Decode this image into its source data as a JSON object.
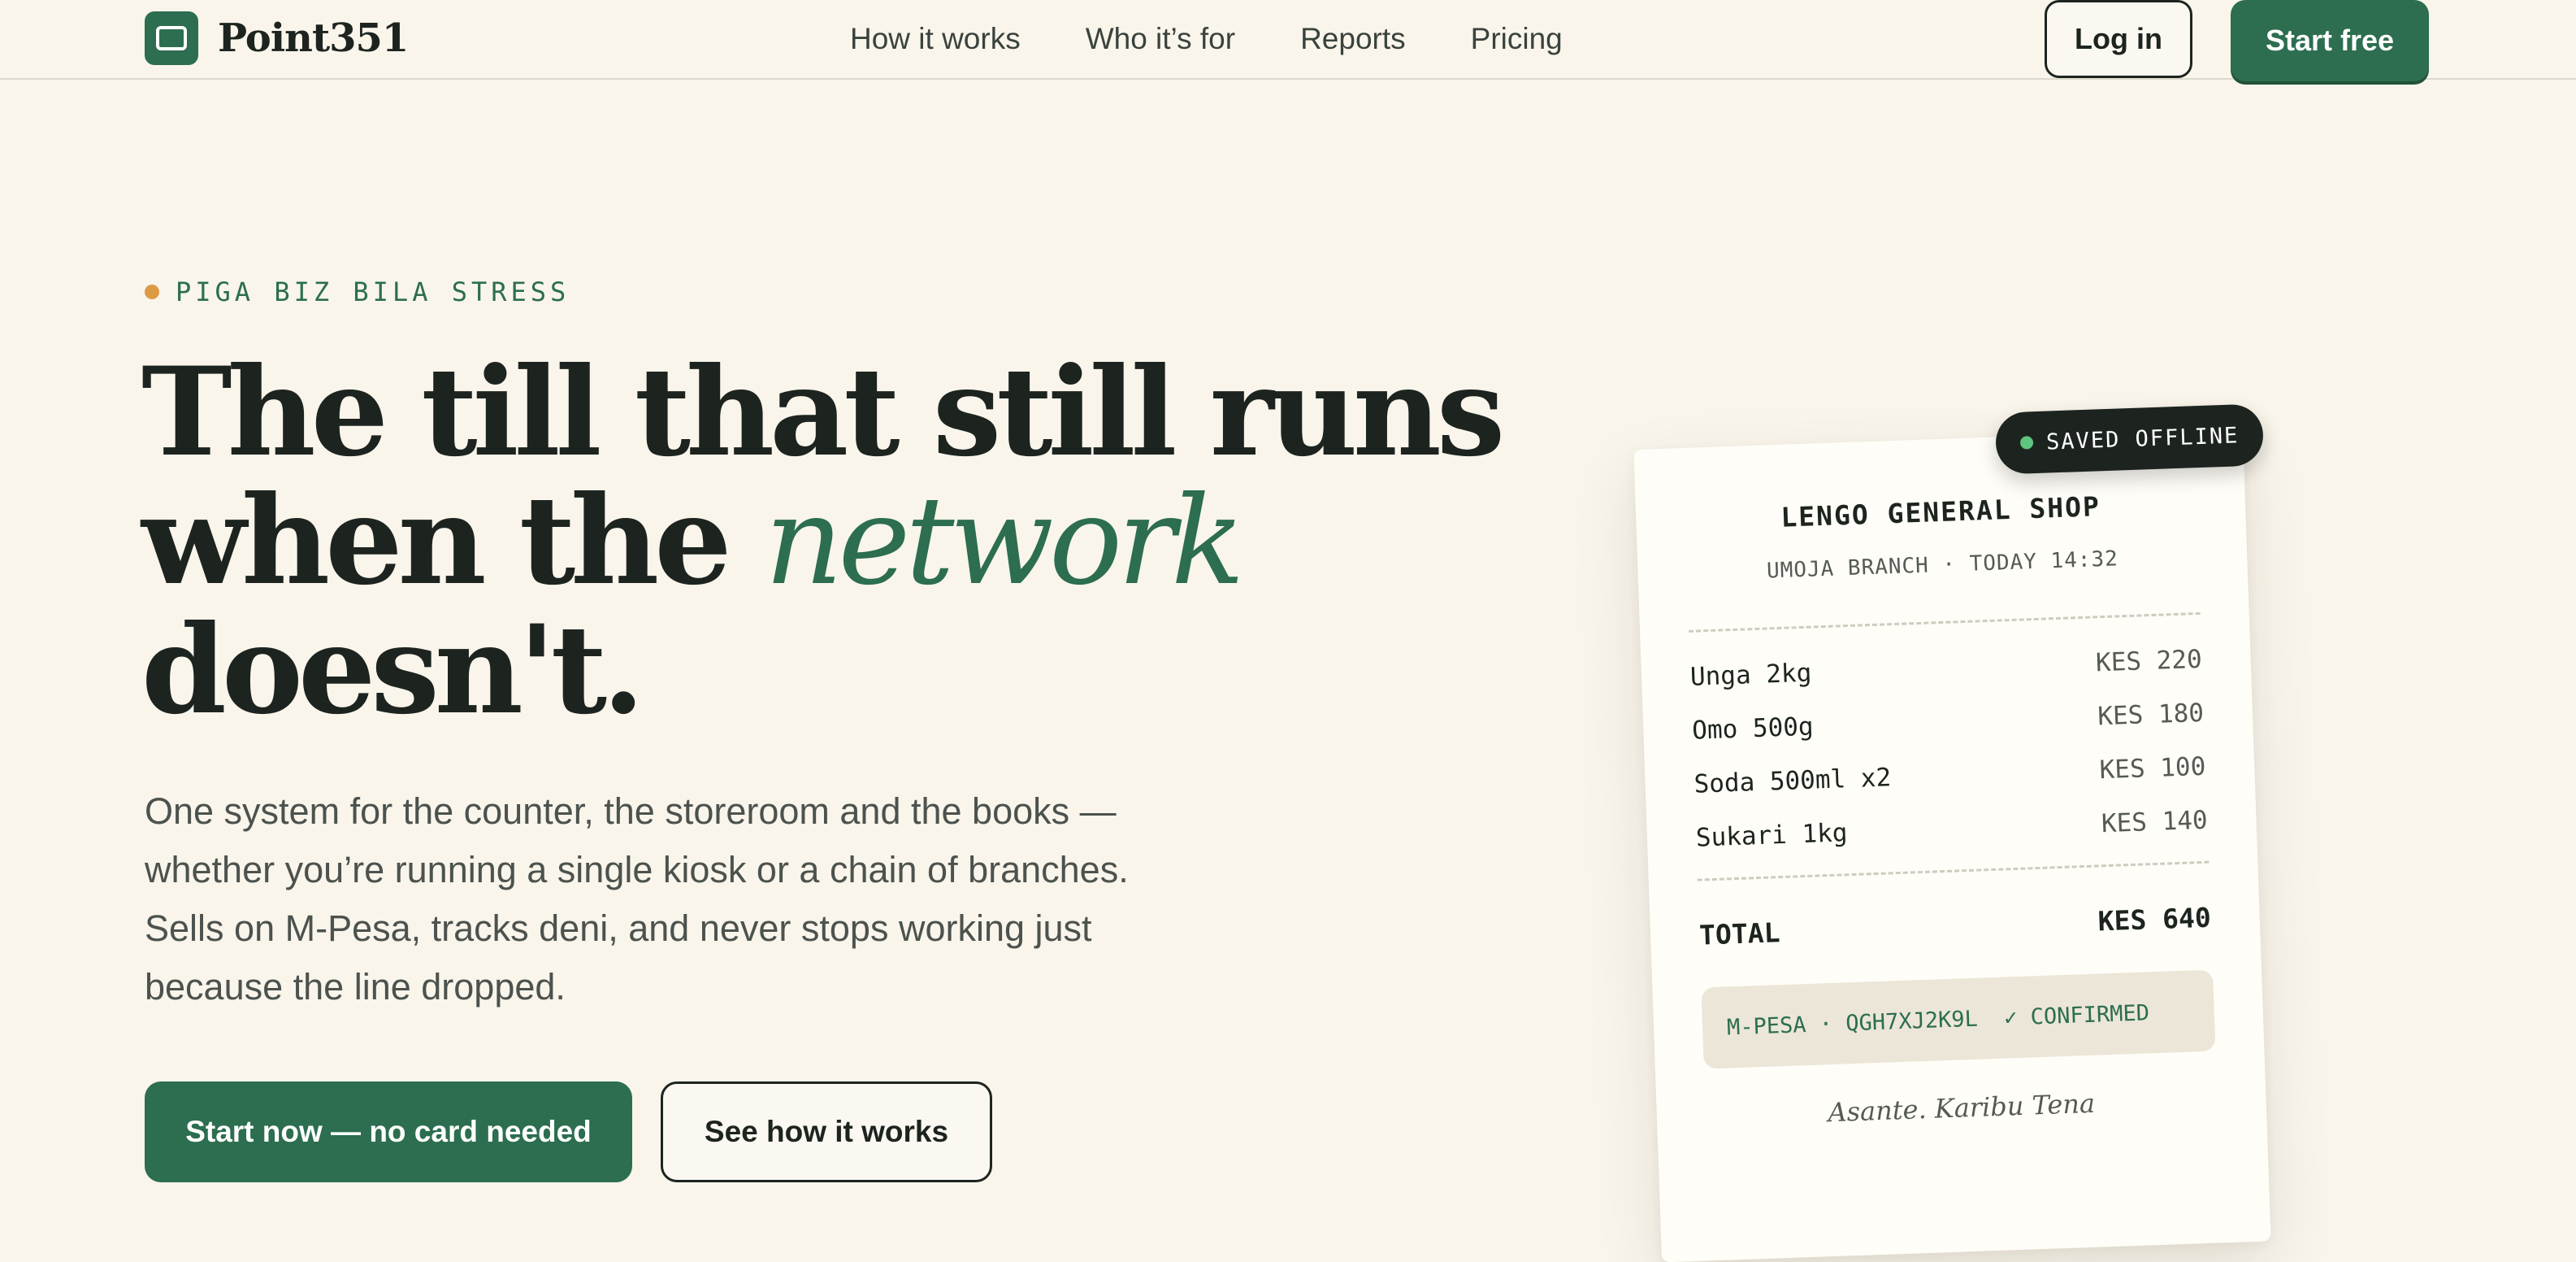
{
  "header": {
    "brand": "Point351",
    "icon": "screen-icon",
    "nav": [
      "How it works",
      "Who it’s for",
      "Reports",
      "Pricing"
    ],
    "login_label": "Log in",
    "cta_label": "Start free"
  },
  "hero": {
    "eyebrow": "PIGA BIZ BILA STRESS",
    "headline": {
      "line1": "The till that still runs",
      "line2_prefix": "when the ",
      "line2_accent": "network",
      "line3": "doesn't."
    },
    "lead": "One system for the counter, the storeroom and the books — whether you’re running a single kiosk or a chain of branches. Sells on M-Pesa, tracks deni, and never stops working just because the line dropped.",
    "primary_label": "Start now — no card needed",
    "secondary_label": "See how it works"
  },
  "receipt": {
    "badge": "SAVED OFFLINE",
    "shop": "LENGO GENERAL SHOP",
    "meta": "UMOJA BRANCH · TODAY 14:32",
    "items": [
      {
        "name": "Unga 2kg",
        "price": "KES 220"
      },
      {
        "name": "Omo 500g",
        "price": "KES 180"
      },
      {
        "name": "Soda 500ml x2",
        "price": "KES 100"
      },
      {
        "name": "Sukari 1kg",
        "price": "KES 140"
      }
    ],
    "total_label": "TOTAL",
    "total_value": "KES 640",
    "payment": "M-PESA · QGH7XJ2K9L  ✓ CONFIRMED",
    "footer": "Asante. Karibu Tena"
  },
  "colors": {
    "brand_green": "#2c6e4f",
    "background": "#f9f5eb",
    "ink": "#1d2420",
    "eyebrow_dot": "#dc9a43",
    "online_dot": "#5ec47f"
  }
}
